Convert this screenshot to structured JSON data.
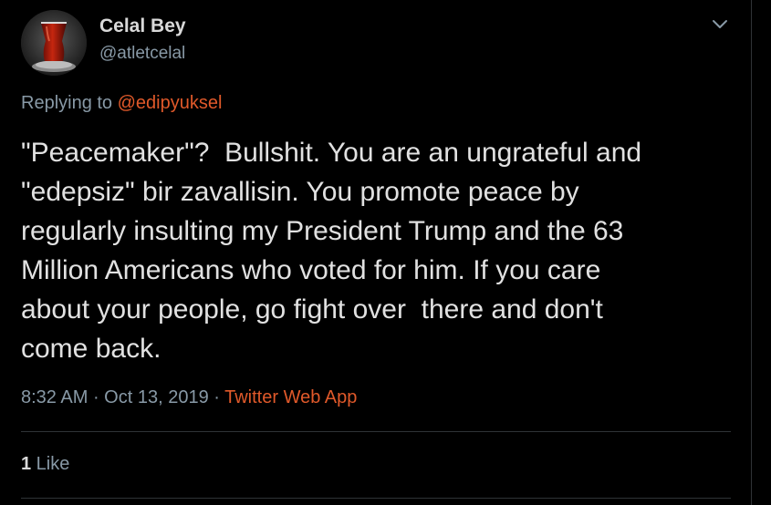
{
  "author": {
    "display_name": "Celal Bey",
    "handle": "@atletcelal",
    "avatar_icon": "tea-glass-avatar"
  },
  "reply": {
    "prefix": "Replying to ",
    "mention": "@edipyuksel"
  },
  "tweet": {
    "text": "\"Peacemaker\"?  Bullshit. You are an ungrateful and\n\"edepsiz\" bir zavallisin. You promote peace by\nregularly insulting my President Trump and the 63\nMillion Americans who voted for him. If you care\nabout your people, go fight over  there and don't\ncome back."
  },
  "meta": {
    "time": "8:32 AM",
    "sep1": " · ",
    "date": "Oct 13, 2019",
    "sep2": " · ",
    "source": "Twitter Web App"
  },
  "stats": {
    "like_count": "1",
    "like_label": " Like"
  },
  "icons": {
    "menu": "chevron-down-icon"
  },
  "colors": {
    "background": "#000000",
    "accent": "#e0592a",
    "text": "#e1e1e1",
    "secondary": "#8899a6",
    "divider": "#2f3336"
  }
}
